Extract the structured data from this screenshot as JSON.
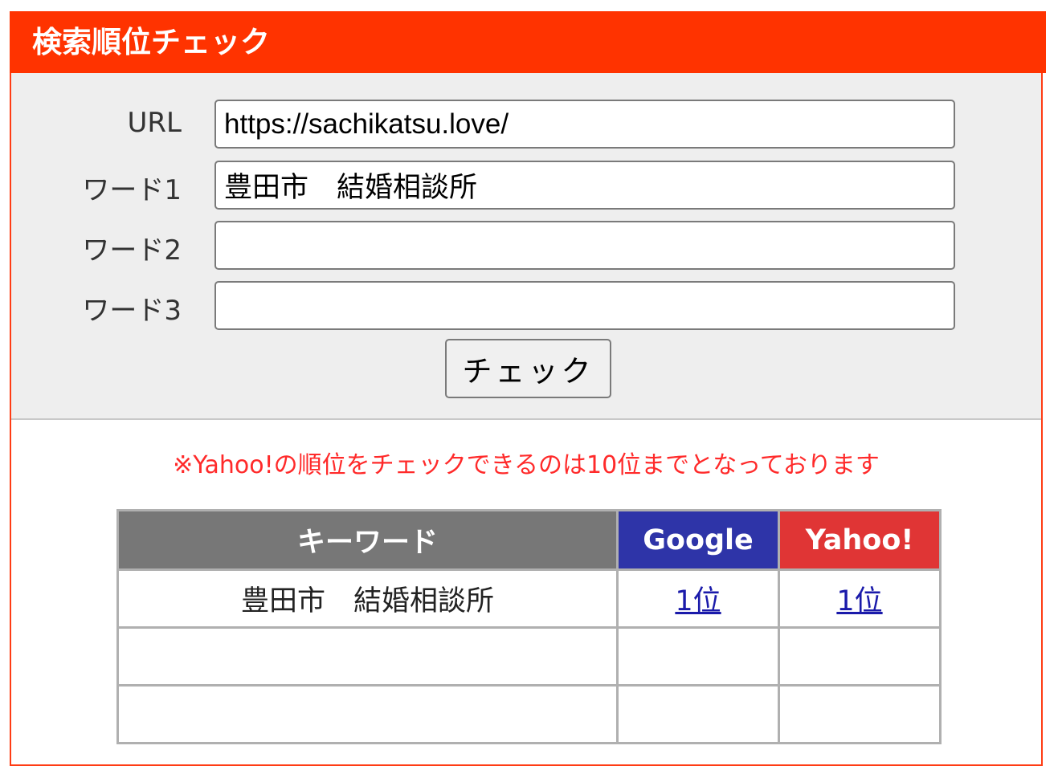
{
  "header": {
    "title": "検索順位チェック"
  },
  "form": {
    "url_label": "URL",
    "url_value": "https://sachikatsu.love/",
    "word1_label": "ワード1",
    "word1_value": "豊田市　結婚相談所",
    "word2_label": "ワード2",
    "word2_value": "",
    "word3_label": "ワード3",
    "word3_value": "",
    "check_button_label": "チェック"
  },
  "notice": "※Yahoo!の順位をチェックできるのは10位までとなっております",
  "results": {
    "headers": {
      "keyword": "キーワード",
      "google": "Google",
      "yahoo": "Yahoo!"
    },
    "rows": [
      {
        "keyword": "豊田市　結婚相談所",
        "google": "1位",
        "yahoo": "1位"
      },
      {
        "keyword": "",
        "google": "",
        "yahoo": ""
      },
      {
        "keyword": "",
        "google": "",
        "yahoo": ""
      }
    ]
  },
  "colors": {
    "brand": "#ff3300",
    "google": "#2e34a8",
    "yahoo": "#e03535",
    "keyword_header": "#777777",
    "notice": "#ff2a2a"
  }
}
